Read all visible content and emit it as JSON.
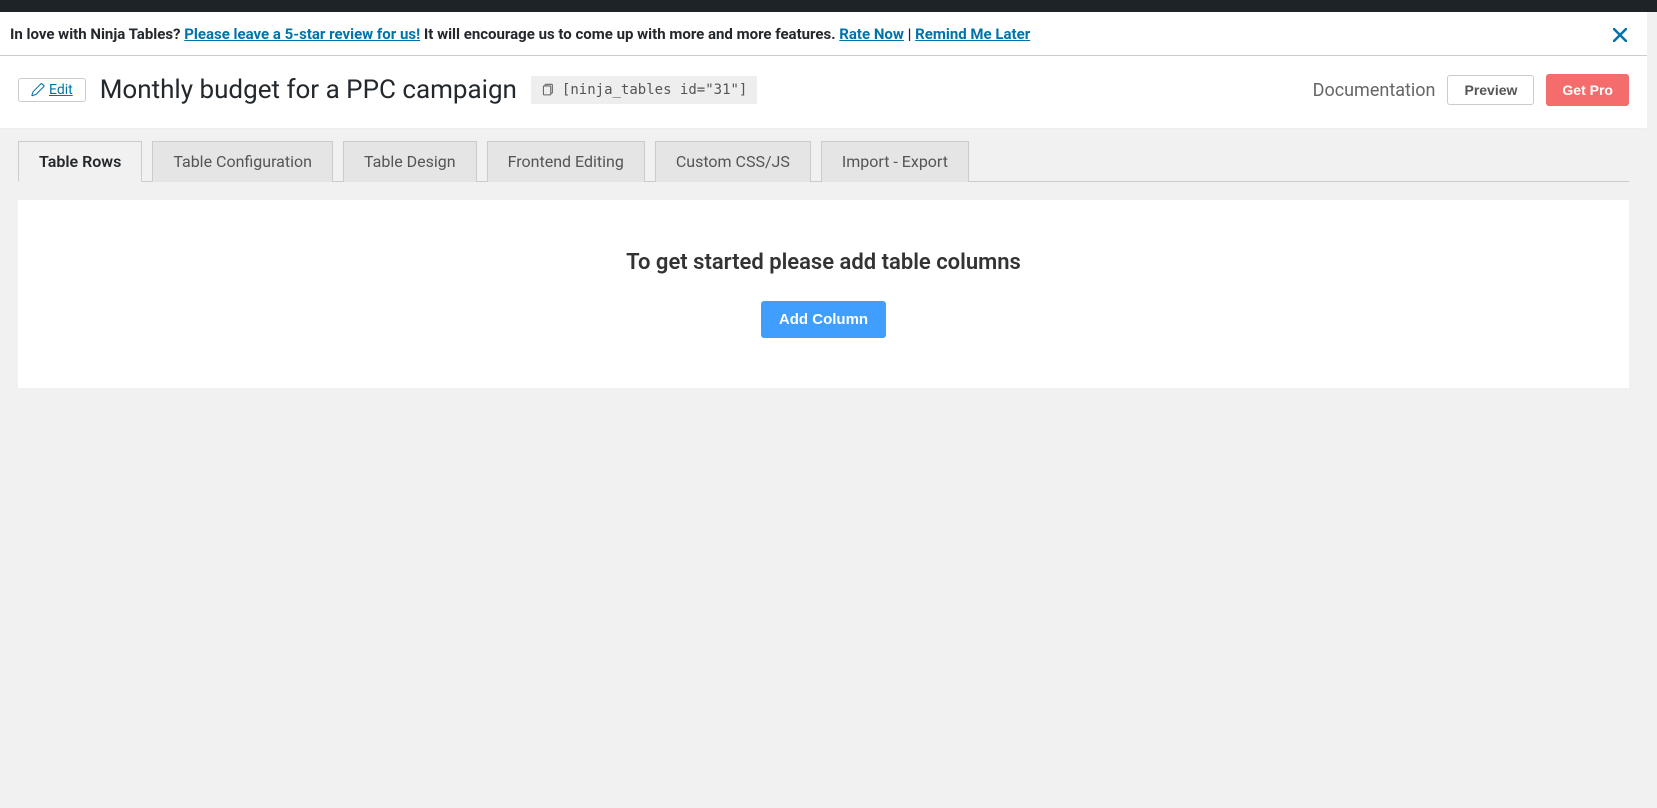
{
  "notice": {
    "pre_text": "In love with Ninja Tables? ",
    "review_link": "Please leave a 5-star review for us!",
    "mid_text": " It will encourage us to come up with more and more features. ",
    "rate_now": "Rate Now",
    "sep": " | ",
    "remind_later": "Remind Me Later"
  },
  "header": {
    "edit_label": "Edit",
    "title": "Monthly budget for a PPC campaign",
    "shortcode": "[ninja_tables id=\"31\"]",
    "documentation": "Documentation",
    "preview": "Preview",
    "get_pro": "Get Pro"
  },
  "tabs": [
    {
      "label": "Table Rows",
      "active": true
    },
    {
      "label": "Table Configuration",
      "active": false
    },
    {
      "label": "Table Design",
      "active": false
    },
    {
      "label": "Frontend Editing",
      "active": false
    },
    {
      "label": "Custom CSS/JS",
      "active": false
    },
    {
      "label": "Import - Export",
      "active": false
    }
  ],
  "content": {
    "empty_title": "To get started please add table columns",
    "add_column": "Add Column"
  }
}
